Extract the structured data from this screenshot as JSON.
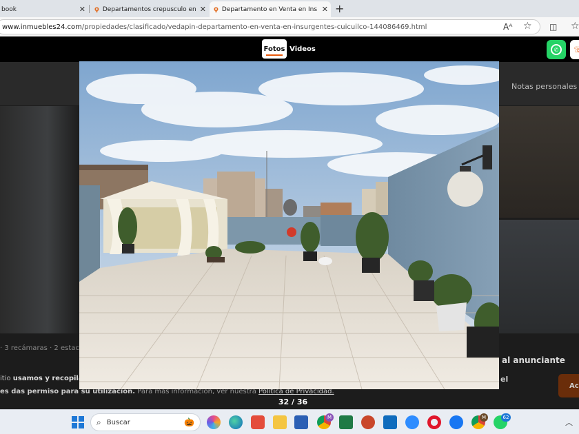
{
  "browser": {
    "tabs": [
      {
        "title": "book",
        "active": false
      },
      {
        "title": "Departamentos crepusculo en Co",
        "active": false
      },
      {
        "title": "Departamento en Venta en Insurg",
        "active": true
      }
    ],
    "new_tab": "+",
    "close_glyph": "✕",
    "url_host": "www.inmuebles24.com",
    "url_path": "/propiedades/clasificado/vedapin-departamento-en-venta-en-insurgentes-cuicuilco-144086469.html",
    "icons": [
      "read-aloud-icon",
      "favorite-star-icon",
      "split-screen-icon",
      "favorites-icon"
    ]
  },
  "viewer": {
    "tabs": [
      {
        "label": "Fotos",
        "active": true
      },
      {
        "label": "Videos",
        "active": false
      }
    ],
    "counter": "32 / 36"
  },
  "background_page": {
    "notas": "Notas personales",
    "features": "· 3 recámaras · 2 estaci",
    "consent_line1_prefix": "itio ",
    "consent_line1_bold": "usamos y recopilar",
    "consent_line2_bold": "es das permiso para su utilización.",
    "consent_line2_text": " Para más información, ver nuestra ",
    "consent_link": "Política de Privacidad.",
    "contact": "al anunciante",
    "contact2": "el",
    "side_button": "Ac"
  },
  "taskbar": {
    "search_placeholder": "Buscar",
    "badges": {
      "chrome_profile": "M",
      "whatsapp": "62",
      "teams": "M"
    }
  },
  "colors": {
    "accent_orange": "#e8590c",
    "whatsapp_green": "#25d366",
    "windows_blue": "#1e78d6"
  }
}
